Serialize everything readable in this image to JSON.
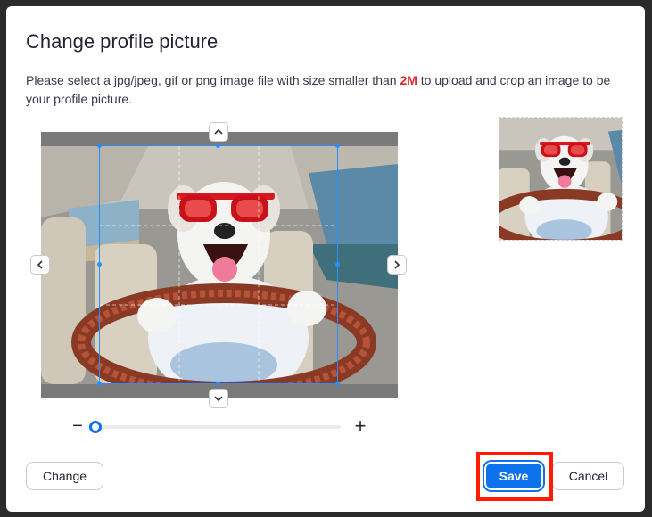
{
  "dialog": {
    "title": "Change profile picture",
    "description_before": "Please select a jpg/jpeg, gif or png image file with size smaller than ",
    "description_size": "2M",
    "description_after": " to upload and crop an image to be your profile picture."
  },
  "cropper": {
    "up_icon": "chevron-up-icon",
    "down_icon": "chevron-down-icon",
    "left_icon": "chevron-left-icon",
    "right_icon": "chevron-right-icon",
    "image_subject": "dog wearing red sunglasses driving a car"
  },
  "zoom": {
    "minus_label": "−",
    "plus_label": "+",
    "level": 0.0
  },
  "buttons": {
    "change_label": "Change",
    "save_label": "Save",
    "cancel_label": "Cancel"
  },
  "colors": {
    "accent": "#0e72ed",
    "crop_border": "#2d8cff",
    "size_highlight": "#e02828",
    "annotation": "#ff1a00"
  }
}
